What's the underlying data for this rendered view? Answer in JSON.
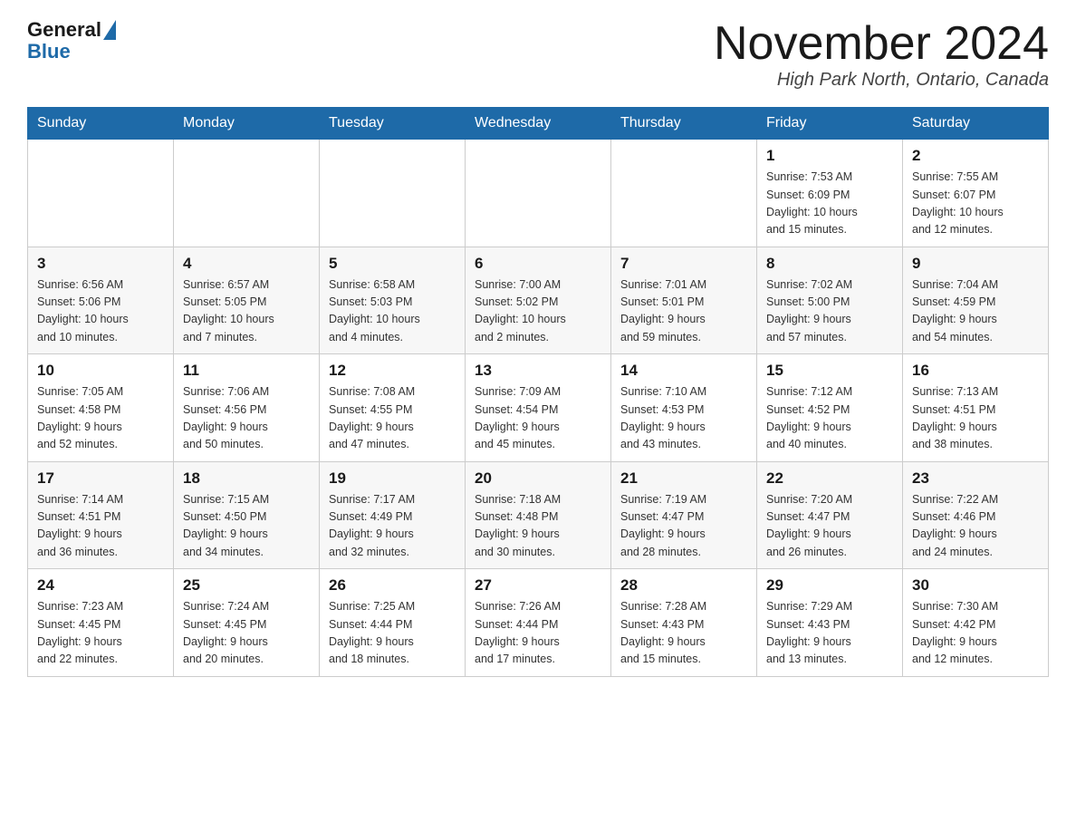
{
  "header": {
    "logo_general": "General",
    "logo_blue": "Blue",
    "month_title": "November 2024",
    "location": "High Park North, Ontario, Canada"
  },
  "days_of_week": [
    "Sunday",
    "Monday",
    "Tuesday",
    "Wednesday",
    "Thursday",
    "Friday",
    "Saturday"
  ],
  "weeks": [
    [
      {
        "day": "",
        "info": ""
      },
      {
        "day": "",
        "info": ""
      },
      {
        "day": "",
        "info": ""
      },
      {
        "day": "",
        "info": ""
      },
      {
        "day": "",
        "info": ""
      },
      {
        "day": "1",
        "info": "Sunrise: 7:53 AM\nSunset: 6:09 PM\nDaylight: 10 hours\nand 15 minutes."
      },
      {
        "day": "2",
        "info": "Sunrise: 7:55 AM\nSunset: 6:07 PM\nDaylight: 10 hours\nand 12 minutes."
      }
    ],
    [
      {
        "day": "3",
        "info": "Sunrise: 6:56 AM\nSunset: 5:06 PM\nDaylight: 10 hours\nand 10 minutes."
      },
      {
        "day": "4",
        "info": "Sunrise: 6:57 AM\nSunset: 5:05 PM\nDaylight: 10 hours\nand 7 minutes."
      },
      {
        "day": "5",
        "info": "Sunrise: 6:58 AM\nSunset: 5:03 PM\nDaylight: 10 hours\nand 4 minutes."
      },
      {
        "day": "6",
        "info": "Sunrise: 7:00 AM\nSunset: 5:02 PM\nDaylight: 10 hours\nand 2 minutes."
      },
      {
        "day": "7",
        "info": "Sunrise: 7:01 AM\nSunset: 5:01 PM\nDaylight: 9 hours\nand 59 minutes."
      },
      {
        "day": "8",
        "info": "Sunrise: 7:02 AM\nSunset: 5:00 PM\nDaylight: 9 hours\nand 57 minutes."
      },
      {
        "day": "9",
        "info": "Sunrise: 7:04 AM\nSunset: 4:59 PM\nDaylight: 9 hours\nand 54 minutes."
      }
    ],
    [
      {
        "day": "10",
        "info": "Sunrise: 7:05 AM\nSunset: 4:58 PM\nDaylight: 9 hours\nand 52 minutes."
      },
      {
        "day": "11",
        "info": "Sunrise: 7:06 AM\nSunset: 4:56 PM\nDaylight: 9 hours\nand 50 minutes."
      },
      {
        "day": "12",
        "info": "Sunrise: 7:08 AM\nSunset: 4:55 PM\nDaylight: 9 hours\nand 47 minutes."
      },
      {
        "day": "13",
        "info": "Sunrise: 7:09 AM\nSunset: 4:54 PM\nDaylight: 9 hours\nand 45 minutes."
      },
      {
        "day": "14",
        "info": "Sunrise: 7:10 AM\nSunset: 4:53 PM\nDaylight: 9 hours\nand 43 minutes."
      },
      {
        "day": "15",
        "info": "Sunrise: 7:12 AM\nSunset: 4:52 PM\nDaylight: 9 hours\nand 40 minutes."
      },
      {
        "day": "16",
        "info": "Sunrise: 7:13 AM\nSunset: 4:51 PM\nDaylight: 9 hours\nand 38 minutes."
      }
    ],
    [
      {
        "day": "17",
        "info": "Sunrise: 7:14 AM\nSunset: 4:51 PM\nDaylight: 9 hours\nand 36 minutes."
      },
      {
        "day": "18",
        "info": "Sunrise: 7:15 AM\nSunset: 4:50 PM\nDaylight: 9 hours\nand 34 minutes."
      },
      {
        "day": "19",
        "info": "Sunrise: 7:17 AM\nSunset: 4:49 PM\nDaylight: 9 hours\nand 32 minutes."
      },
      {
        "day": "20",
        "info": "Sunrise: 7:18 AM\nSunset: 4:48 PM\nDaylight: 9 hours\nand 30 minutes."
      },
      {
        "day": "21",
        "info": "Sunrise: 7:19 AM\nSunset: 4:47 PM\nDaylight: 9 hours\nand 28 minutes."
      },
      {
        "day": "22",
        "info": "Sunrise: 7:20 AM\nSunset: 4:47 PM\nDaylight: 9 hours\nand 26 minutes."
      },
      {
        "day": "23",
        "info": "Sunrise: 7:22 AM\nSunset: 4:46 PM\nDaylight: 9 hours\nand 24 minutes."
      }
    ],
    [
      {
        "day": "24",
        "info": "Sunrise: 7:23 AM\nSunset: 4:45 PM\nDaylight: 9 hours\nand 22 minutes."
      },
      {
        "day": "25",
        "info": "Sunrise: 7:24 AM\nSunset: 4:45 PM\nDaylight: 9 hours\nand 20 minutes."
      },
      {
        "day": "26",
        "info": "Sunrise: 7:25 AM\nSunset: 4:44 PM\nDaylight: 9 hours\nand 18 minutes."
      },
      {
        "day": "27",
        "info": "Sunrise: 7:26 AM\nSunset: 4:44 PM\nDaylight: 9 hours\nand 17 minutes."
      },
      {
        "day": "28",
        "info": "Sunrise: 7:28 AM\nSunset: 4:43 PM\nDaylight: 9 hours\nand 15 minutes."
      },
      {
        "day": "29",
        "info": "Sunrise: 7:29 AM\nSunset: 4:43 PM\nDaylight: 9 hours\nand 13 minutes."
      },
      {
        "day": "30",
        "info": "Sunrise: 7:30 AM\nSunset: 4:42 PM\nDaylight: 9 hours\nand 12 minutes."
      }
    ]
  ]
}
